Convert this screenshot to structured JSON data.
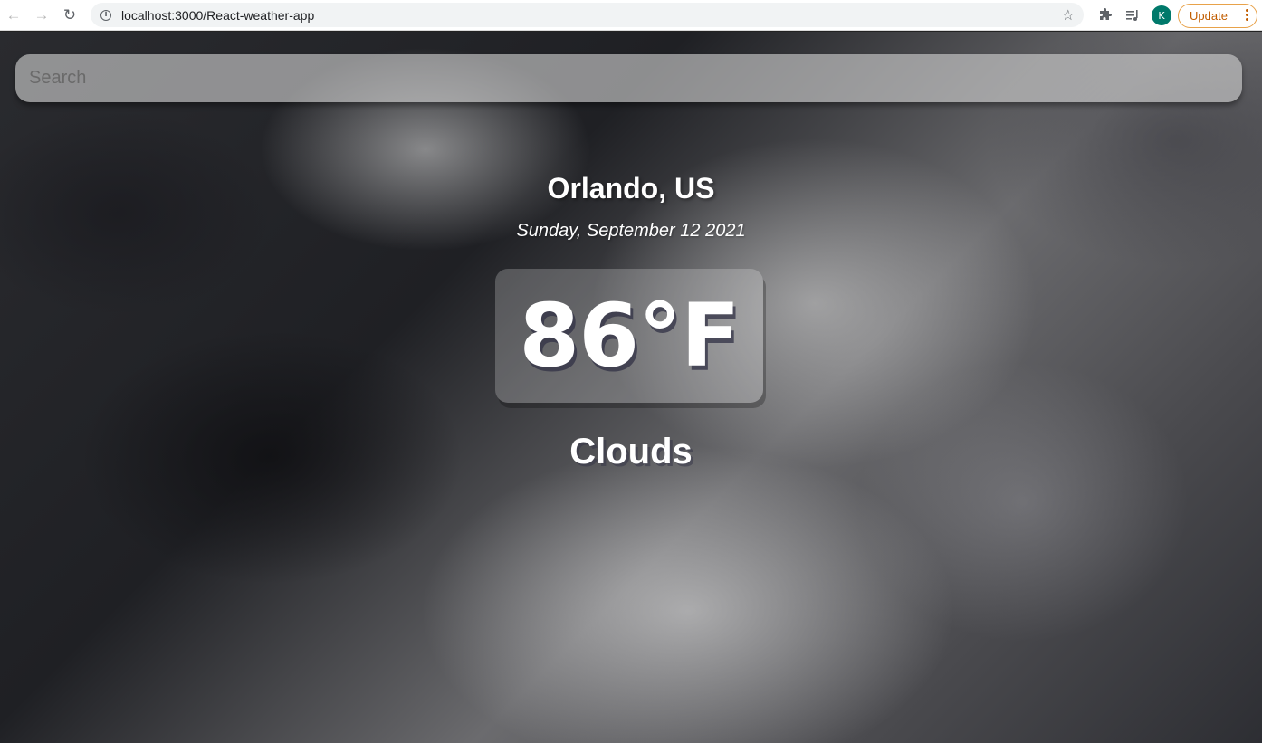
{
  "browser": {
    "url": "localhost:3000/React-weather-app",
    "profile_initial": "K",
    "update_label": "Update"
  },
  "search": {
    "placeholder": "Search",
    "value": ""
  },
  "weather": {
    "location": "Orlando, US",
    "date": "Sunday, September 12 2021",
    "temperature": "86°F",
    "condition": "Clouds"
  },
  "colors": {
    "avatar": "#00796b",
    "update_accent": "#c15d00"
  }
}
